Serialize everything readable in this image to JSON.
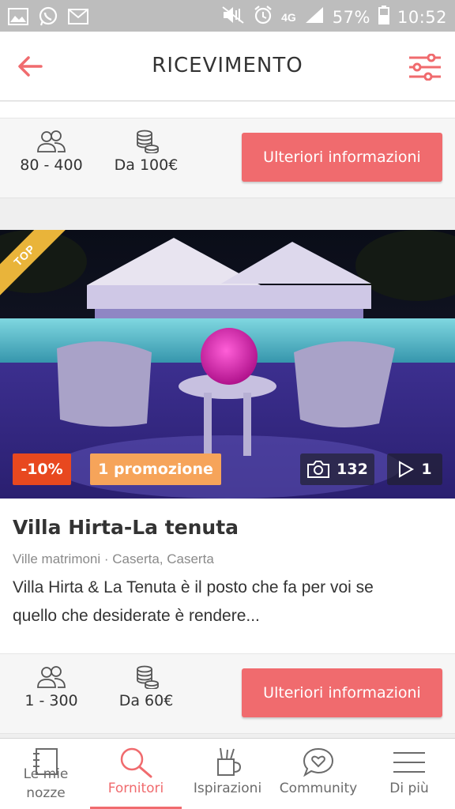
{
  "status_bar": {
    "network": "4G",
    "battery": "57%",
    "time": "10:52"
  },
  "header": {
    "title": "RICEVIMENTO"
  },
  "listing_prev": {
    "capacity": "80 - 400",
    "price": "Da 100€",
    "cta": "Ulteriori informazioni"
  },
  "listing": {
    "top_badge": "TOP",
    "discount": "-10%",
    "promo": "1 promozione",
    "photo_count": "132",
    "video_count": "1",
    "name": "Villa Hirta-La tenuta",
    "meta": "Ville matrimoni · Caserta, Caserta",
    "description_line1": "Villa Hirta & La Tenuta è il posto che fa per voi se",
    "description_line2": "quello che desiderate è rendere...",
    "capacity": "1 - 300",
    "price": "Da 60€",
    "cta": "Ulteriori informazioni"
  },
  "bottom_nav": {
    "items": [
      {
        "label_line1": "Le mie",
        "label_line2": "nozze",
        "icon": "notebook-icon"
      },
      {
        "label": "Fornitori",
        "icon": "search-icon"
      },
      {
        "label": "Ispirazioni",
        "icon": "pencil-cup-icon"
      },
      {
        "label": "Community",
        "icon": "chat-heart-icon"
      },
      {
        "label": "Di più",
        "icon": "menu-icon"
      }
    ],
    "active": "Fornitori"
  },
  "colors": {
    "accent": "#f06b6e",
    "discount": "#e8481f",
    "promo": "#f6a45a",
    "top_ribbon": "#e9b43a"
  }
}
